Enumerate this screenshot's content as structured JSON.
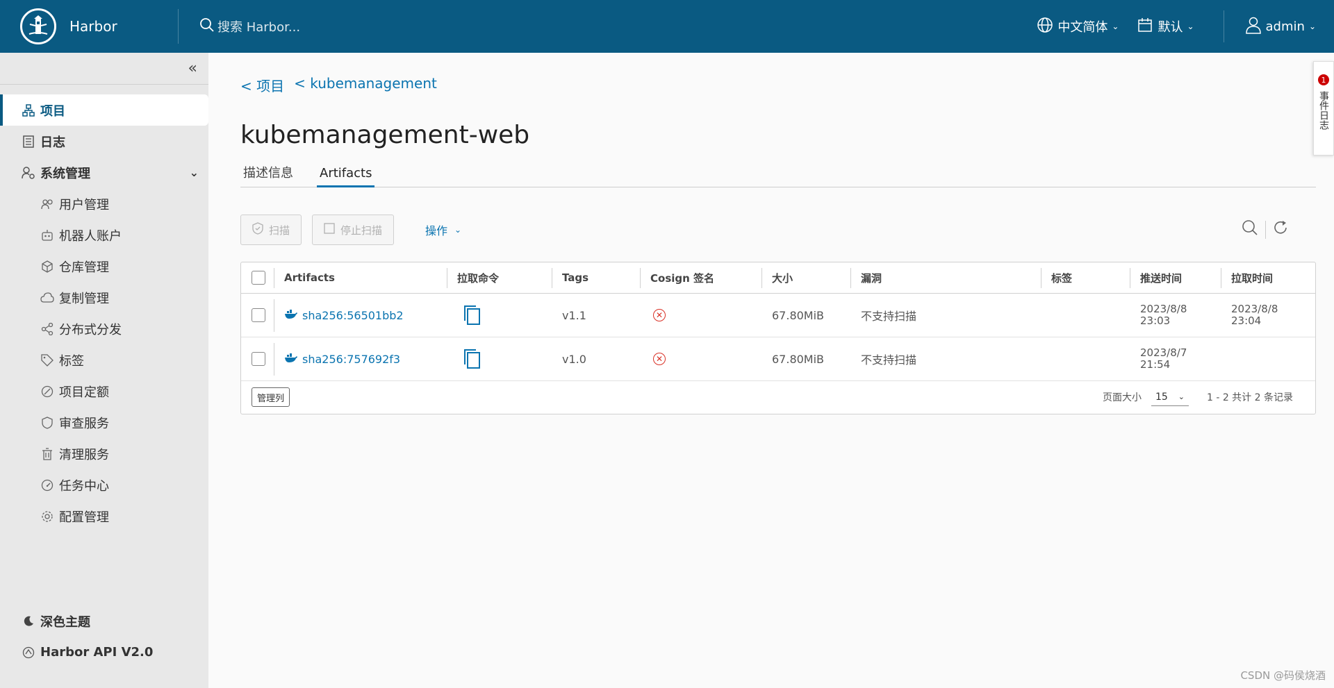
{
  "header": {
    "brand": "Harbor",
    "search_placeholder": "搜索 Harbor...",
    "language": "中文简体",
    "theme": "默认",
    "user": "admin"
  },
  "sidebar": {
    "items": [
      {
        "label": "项目",
        "icon": "projects-icon"
      },
      {
        "label": "日志",
        "icon": "logs-icon"
      },
      {
        "label": "系统管理",
        "icon": "admin-icon"
      }
    ],
    "sub_items": [
      {
        "label": "用户管理",
        "icon": "users-icon"
      },
      {
        "label": "机器人账户",
        "icon": "robot-icon"
      },
      {
        "label": "仓库管理",
        "icon": "registry-icon"
      },
      {
        "label": "复制管理",
        "icon": "replication-icon"
      },
      {
        "label": "分布式分发",
        "icon": "distribution-icon"
      },
      {
        "label": "标签",
        "icon": "tag-icon"
      },
      {
        "label": "项目定额",
        "icon": "quota-icon"
      },
      {
        "label": "审查服务",
        "icon": "shield-icon"
      },
      {
        "label": "清理服务",
        "icon": "trash-icon"
      },
      {
        "label": "任务中心",
        "icon": "dashboard-icon"
      },
      {
        "label": "配置管理",
        "icon": "gear-icon"
      }
    ],
    "bottom": {
      "dark_theme": "深色主题",
      "api": "Harbor API V2.0"
    }
  },
  "breadcrumb": {
    "project": "< 项目",
    "repo": "< kubemanagement"
  },
  "page_title": "kubemanagement-web",
  "tabs": [
    "描述信息",
    "Artifacts"
  ],
  "toolbar": {
    "scan": "扫描",
    "stop_scan": "停止扫描",
    "actions": "操作"
  },
  "table": {
    "headers": [
      "Artifacts",
      "拉取命令",
      "Tags",
      "Cosign 签名",
      "大小",
      "漏洞",
      "标签",
      "推送时间",
      "拉取时间"
    ],
    "rows": [
      {
        "artifact": "sha256:56501bb2",
        "tags": "v1.1",
        "size": "67.80MiB",
        "vuln": "不支持扫描",
        "labels": "",
        "push_date": "2023/8/8",
        "push_time": "23:03",
        "pull_date": "2023/8/8",
        "pull_time": "23:04"
      },
      {
        "artifact": "sha256:757692f3",
        "tags": "v1.0",
        "size": "67.80MiB",
        "vuln": "不支持扫描",
        "labels": "",
        "push_date": "2023/8/7",
        "push_time": "21:54",
        "pull_date": "",
        "pull_time": ""
      }
    ],
    "footer": {
      "manage_columns": "管理列",
      "page_size_label": "页面大小",
      "page_size": "15",
      "range": "1 - 2 共计 2 条记录"
    }
  },
  "side_tab": {
    "badge": "1",
    "label": "事件日志"
  },
  "watermark": "CSDN @码侯烧酒",
  "colors": {
    "header_bg": "#0a5a82",
    "accent": "#0b74b0",
    "error": "#d93025"
  }
}
